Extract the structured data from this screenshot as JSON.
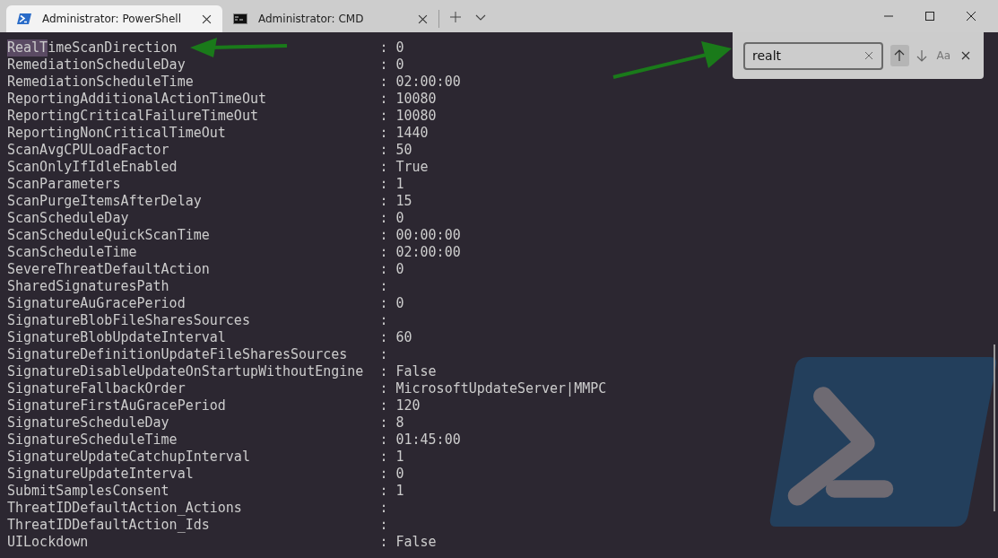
{
  "tabs": [
    {
      "label": "Administrator: PowerShell",
      "selected": true
    },
    {
      "label": "Administrator: CMD",
      "selected": false
    }
  ],
  "find": {
    "value": "realt",
    "buttons": [
      {
        "kind": "up",
        "selected": true
      },
      {
        "kind": "down",
        "selected": false
      },
      {
        "kind": "case",
        "text": "Aa",
        "selected": false
      },
      {
        "kind": "close",
        "selected": false
      }
    ]
  },
  "output": [
    {
      "key_match": "RealT",
      "key": "imeScanDirection",
      "sep": ":",
      "value": "0"
    },
    {
      "key": "RemediationScheduleDay",
      "sep": ":",
      "value": "0"
    },
    {
      "key": "RemediationScheduleTime",
      "sep": ":",
      "value": "02:00:00"
    },
    {
      "key": "ReportingAdditionalActionTimeOut",
      "sep": ":",
      "value": "10080"
    },
    {
      "key": "ReportingCriticalFailureTimeOut",
      "sep": ":",
      "value": "10080"
    },
    {
      "key": "ReportingNonCriticalTimeOut",
      "sep": ":",
      "value": "1440"
    },
    {
      "key": "ScanAvgCPULoadFactor",
      "sep": ":",
      "value": "50"
    },
    {
      "key": "ScanOnlyIfIdleEnabled",
      "sep": ":",
      "value": "True"
    },
    {
      "key": "ScanParameters",
      "sep": ":",
      "value": "1"
    },
    {
      "key": "ScanPurgeItemsAfterDelay",
      "sep": ":",
      "value": "15"
    },
    {
      "key": "ScanScheduleDay",
      "sep": ":",
      "value": "0"
    },
    {
      "key": "ScanScheduleQuickScanTime",
      "sep": ":",
      "value": "00:00:00"
    },
    {
      "key": "ScanScheduleTime",
      "sep": ":",
      "value": "02:00:00"
    },
    {
      "key": "SevereThreatDefaultAction",
      "sep": ":",
      "value": "0"
    },
    {
      "key": "SharedSignaturesPath",
      "sep": ":"
    },
    {
      "key": "SignatureAuGracePeriod",
      "sep": ":",
      "value": "0"
    },
    {
      "key": "SignatureBlobFileSharesSources",
      "sep": ":"
    },
    {
      "key": "SignatureBlobUpdateInterval",
      "sep": ":",
      "value": "60"
    },
    {
      "key": "SignatureDefinitionUpdateFileSharesSources",
      "sep": ":"
    },
    {
      "key": "SignatureDisableUpdateOnStartupWithoutEngine",
      "sep": ":",
      "value": "False"
    },
    {
      "key": "SignatureFallbackOrder",
      "sep": ":",
      "value": "MicrosoftUpdateServer|MMPC"
    },
    {
      "key": "SignatureFirstAuGracePeriod",
      "sep": ":",
      "value": "120"
    },
    {
      "key": "SignatureScheduleDay",
      "sep": ":",
      "value": "8"
    },
    {
      "key": "SignatureScheduleTime",
      "sep": ":",
      "value": "01:45:00"
    },
    {
      "key": "SignatureUpdateCatchupInterval",
      "sep": ":",
      "value": "1"
    },
    {
      "key": "SignatureUpdateInterval",
      "sep": ":",
      "value": "0"
    },
    {
      "key": "SubmitSamplesConsent",
      "sep": ":",
      "value": "1"
    },
    {
      "key": "ThreatIDDefaultAction_Actions",
      "sep": ":"
    },
    {
      "key": "ThreatIDDefaultAction_Ids",
      "sep": ":"
    },
    {
      "key": "UILockdown",
      "sep": ":",
      "value": "False"
    }
  ]
}
